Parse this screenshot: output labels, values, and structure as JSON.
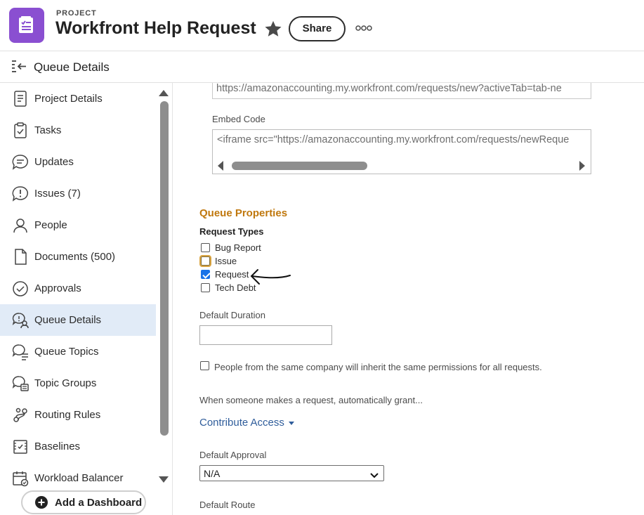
{
  "header": {
    "project_label": "PROJECT",
    "title": "Workfront Help Request",
    "share_label": "Share",
    "brand_color": "#8a4fd1"
  },
  "subheader": {
    "title": "Queue Details"
  },
  "sidebar": {
    "items": [
      {
        "label": "Project Details",
        "icon": "document-icon"
      },
      {
        "label": "Tasks",
        "icon": "clipboard-check-icon"
      },
      {
        "label": "Updates",
        "icon": "chat-bubble-icon"
      },
      {
        "label": "Issues (7)",
        "icon": "issue-bubble-icon"
      },
      {
        "label": "People",
        "icon": "person-icon"
      },
      {
        "label": "Documents (500)",
        "icon": "file-icon"
      },
      {
        "label": "Approvals",
        "icon": "approval-check-icon"
      },
      {
        "label": "Queue Details",
        "icon": "queue-details-icon",
        "active": true
      },
      {
        "label": "Queue Topics",
        "icon": "queue-topics-icon"
      },
      {
        "label": "Topic Groups",
        "icon": "topic-groups-icon"
      },
      {
        "label": "Routing Rules",
        "icon": "routing-icon"
      },
      {
        "label": "Baselines",
        "icon": "baselines-icon"
      },
      {
        "label": "Workload Balancer",
        "icon": "calendar-check-icon"
      }
    ],
    "add_dashboard_label": "Add a Dashboard",
    "active_color": "#e1ebf7"
  },
  "main": {
    "url_value": "https://amazonaccounting.my.workfront.com/requests/new?activeTab=tab-ne",
    "embed_label": "Embed Code",
    "embed_value": "<iframe src=\"https://amazonaccounting.my.workfront.com/requests/newReque",
    "queue_properties_title": "Queue Properties",
    "queue_properties_color": "#c0780e",
    "request_types_label": "Request Types",
    "request_types": [
      {
        "label": "Bug Report",
        "checked": false
      },
      {
        "label": "Issue",
        "checked": false,
        "focused": true
      },
      {
        "label": "Request",
        "checked": true
      },
      {
        "label": "Tech Debt",
        "checked": false
      }
    ],
    "default_duration_label": "Default Duration",
    "default_duration_value": "",
    "permissions_label": "People from the same company will inherit the same permissions for all requests.",
    "grant_text": "When someone makes a request, automatically grant...",
    "access_label": "Contribute Access",
    "default_approval_label": "Default Approval",
    "default_approval_value": "N/A",
    "default_route_label": "Default Route"
  }
}
